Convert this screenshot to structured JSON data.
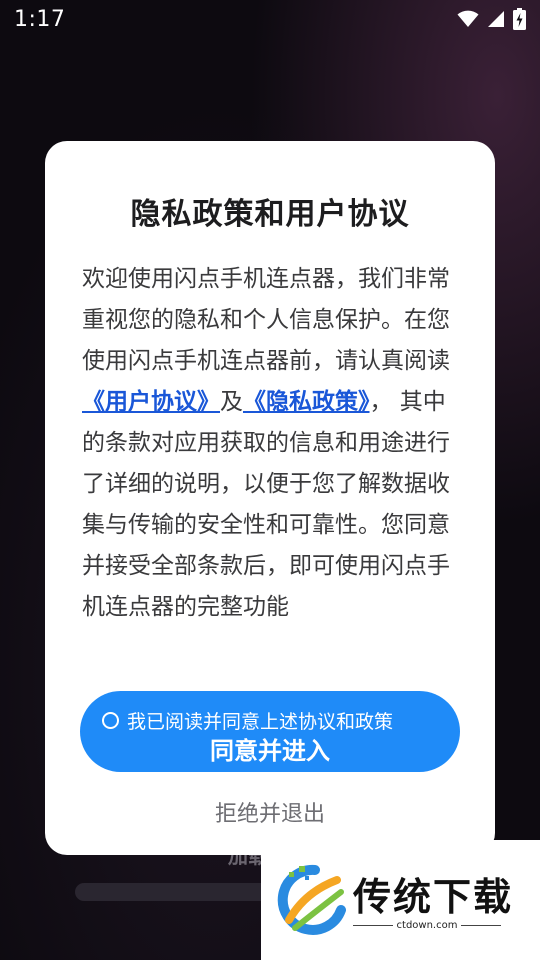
{
  "status_bar": {
    "time": "1:17",
    "icons": [
      "wifi-icon",
      "signal-icon",
      "battery-charging-icon"
    ]
  },
  "background": {
    "loading_text": "加载"
  },
  "dialog": {
    "title": "隐私政策和用户协议",
    "body": {
      "intro": "欢迎使用闪点手机连点器，我们非常重视您的隐私和个人信息保护。在您使用闪点手机连点器前，请认真阅读",
      "user_agreement_link": "《用户协议》",
      "conjunction": "及",
      "privacy_policy_link": "《隐私政策》",
      "outro": "， 其中的条款对应用获取的信息和用途进行了详细的说明，以便于您了解数据收集与传输的安全性和可靠性。您同意并接受全部条款后，即可使用闪点手机连点器的完整功能"
    },
    "consent_label": "我已阅读并同意上述协议和政策",
    "accept_button": "同意并进入",
    "reject_button": "拒绝并退出"
  },
  "watermark": {
    "name": "传统下载",
    "url": "ctdown.com"
  },
  "colors": {
    "primary": "#1f8bf8",
    "link": "#1a57d8",
    "dialog_bg": "#ffffff",
    "screen_bg": "#0d0a10"
  }
}
